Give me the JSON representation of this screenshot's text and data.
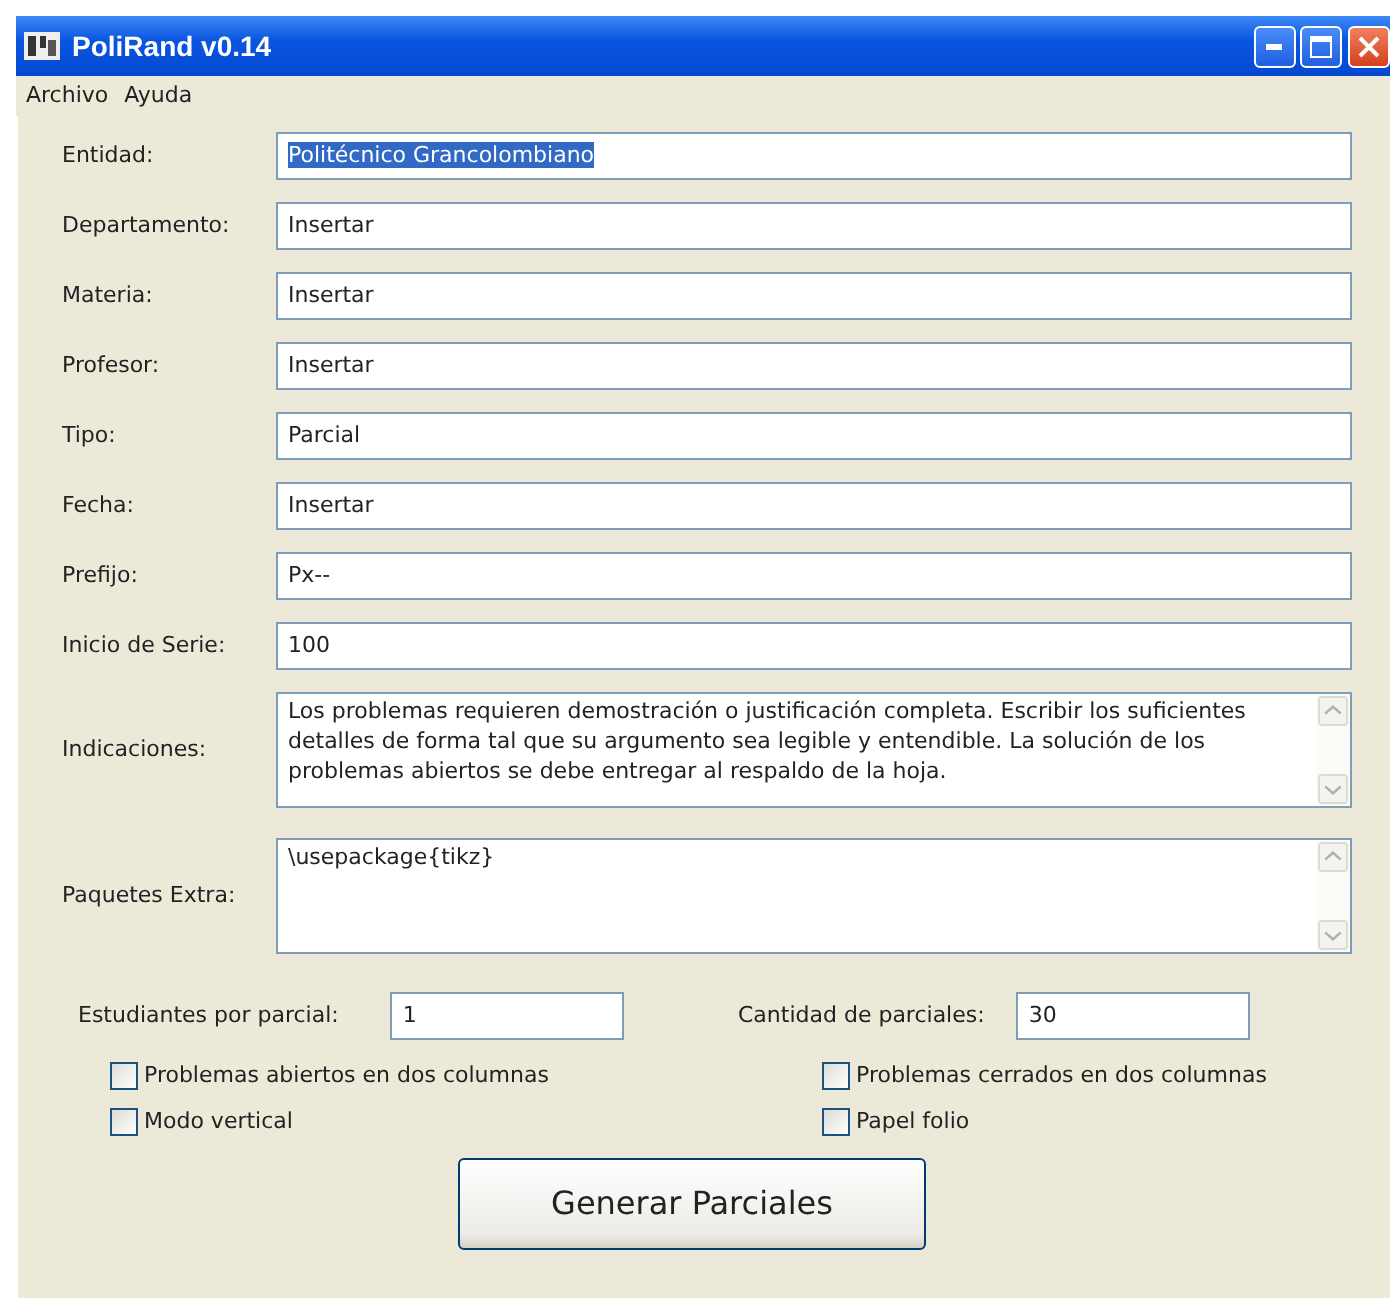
{
  "window": {
    "title": "PoliRand v0.14"
  },
  "menu": [
    "Archivo",
    "Ayuda"
  ],
  "fields": [
    {
      "label": "Entidad:",
      "value": "Politécnico Grancolombiano",
      "text_selected": true
    },
    {
      "label": "Departamento:",
      "value": "Insertar",
      "text_selected": false
    },
    {
      "label": "Materia:",
      "value": "Insertar",
      "text_selected": false
    },
    {
      "label": "Profesor:",
      "value": "Insertar",
      "text_selected": false
    },
    {
      "label": "Tipo:",
      "value": "Parcial",
      "text_selected": false
    },
    {
      "label": "Fecha:",
      "value": "Insertar",
      "text_selected": false
    },
    {
      "label": "Prefijo:",
      "value": "Px--",
      "text_selected": false
    },
    {
      "label": "Inicio de Serie:",
      "value": "100",
      "text_selected": false
    }
  ],
  "text_areas": [
    {
      "label": "Indicaciones:",
      "value": "Los problemas requieren demostración o justificación completa. Escribir los suficientes detalles de forma tal que su argumento sea legible y entendible. La solución de los problemas abiertos se debe entregar al respaldo de la hoja."
    },
    {
      "label": "Paquetes Extra:",
      "value": "\\usepackage{tikz}"
    }
  ],
  "counts": [
    {
      "label": "Estudiantes por parcial:",
      "value": "1"
    },
    {
      "label": "Cantidad de parciales:",
      "value": "30"
    }
  ],
  "checkboxes": [
    {
      "label": "Problemas abiertos en dos columnas",
      "checked": false
    },
    {
      "label": "Problemas cerrados en dos columnas",
      "checked": false
    },
    {
      "label": "Modo vertical",
      "checked": false
    },
    {
      "label": "Papel folio",
      "checked": false
    }
  ],
  "button": "Generar Parciales"
}
